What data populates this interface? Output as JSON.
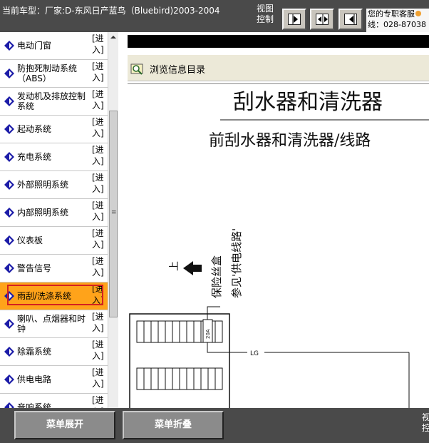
{
  "topbar": {
    "vehicle_text": "当前车型：厂家:D-东风日产蓝鸟（Bluebird)2003-2004",
    "view_control_label": "视图控制",
    "support_line1": "您的专职客服",
    "support_line2": "线：028-87038"
  },
  "sidebar": {
    "items": [
      {
        "label": "电动门窗",
        "enter": "[进入]"
      },
      {
        "label": "防抱死制动系统（ABS）",
        "enter": "[进入]"
      },
      {
        "label": "发动机及排放控制系统",
        "enter": "[进入]"
      },
      {
        "label": "起动系统",
        "enter": "[进入]"
      },
      {
        "label": "充电系统",
        "enter": "[进入]"
      },
      {
        "label": "外部照明系统",
        "enter": "[进入]"
      },
      {
        "label": "内部照明系统",
        "enter": "[进入]"
      },
      {
        "label": "仪表板",
        "enter": "[进入]"
      },
      {
        "label": "警告信号",
        "enter": "[进入]"
      },
      {
        "label": "雨刮/洗涤系统",
        "enter": "[进入]"
      },
      {
        "label": "喇叭、点烟器和时钟",
        "enter": "[进入]"
      },
      {
        "label": "除霜系统",
        "enter": "[进入]"
      },
      {
        "label": "供电电路",
        "enter": "[进入]"
      },
      {
        "label": "音响系统",
        "enter": "[进入]"
      }
    ],
    "active_index": 9
  },
  "viewer": {
    "browse_label": "浏览信息目录",
    "doc_title": "刮水器和清洗器",
    "doc_subtitle": "前刮水器和清洗器/线路",
    "direction_label": "上",
    "fuse_label_1": "保险丝盒",
    "fuse_label_2": "参见'供电线路'",
    "fuse_rating": "20A",
    "wire_label": "LG"
  },
  "bottombar": {
    "expand_label": "菜单展开",
    "collapse_label": "菜单折叠",
    "right_label": "视控"
  },
  "colors": {
    "bar_bg": "#4a4a4a",
    "active_item": "#ffa31a",
    "active_border": "#d42020",
    "icon_blue": "#1c1ca8"
  }
}
